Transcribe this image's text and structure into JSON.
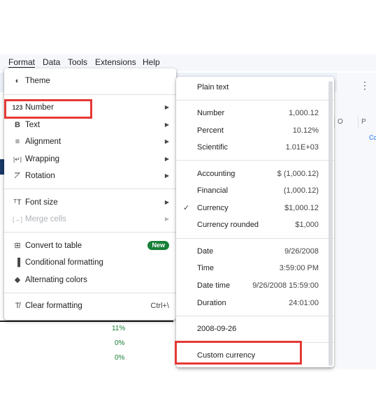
{
  "menubar": {
    "items": [
      "Format",
      "Data",
      "Tools",
      "Extensions",
      "Help"
    ]
  },
  "format_menu": {
    "items": [
      {
        "icon": "palette-icon",
        "glyph": "◐",
        "label": "Theme"
      },
      {
        "icon": "number-format-icon",
        "glyph": "123",
        "label": "Number"
      },
      {
        "icon": "bold-icon",
        "glyph": "B",
        "label": "Text"
      },
      {
        "icon": "align-icon",
        "glyph": "≡",
        "label": "Alignment"
      },
      {
        "icon": "wrap-icon",
        "glyph": "|↵|",
        "label": "Wrapping"
      },
      {
        "icon": "rotate-icon",
        "glyph": "⦢",
        "label": "Rotation"
      },
      {
        "icon": "font-size-icon",
        "glyph": "ᵀT",
        "label": "Font size"
      },
      {
        "icon": "merge-icon",
        "glyph": "[↔]",
        "label": "Merge cells"
      },
      {
        "icon": "table-icon",
        "glyph": "⊞",
        "label": "Convert to table"
      },
      {
        "icon": "paint-roller-icon",
        "glyph": "▐",
        "label": "Conditional formatting"
      },
      {
        "icon": "fill-drop-icon",
        "glyph": "◆",
        "label": "Alternating colors"
      },
      {
        "icon": "clear-format-icon",
        "glyph": "T̸",
        "label": "Clear formatting"
      }
    ],
    "new_badge": "New",
    "clear_shortcut": "Ctrl+\\"
  },
  "number_submenu": {
    "plain_text": "Plain text",
    "group1": [
      {
        "label": "Number",
        "value": "1,000.12"
      },
      {
        "label": "Percent",
        "value": "10.12%"
      },
      {
        "label": "Scientific",
        "value": "1.01E+03"
      }
    ],
    "group2": [
      {
        "label": "Accounting",
        "value": "$ (1,000.12)"
      },
      {
        "label": "Financial",
        "value": "(1,000.12)"
      },
      {
        "label": "Currency",
        "value": "$1,000.12",
        "checked": true
      },
      {
        "label": "Currency rounded",
        "value": "$1,000"
      }
    ],
    "group3": [
      {
        "label": "Date",
        "value": "9/26/2008"
      },
      {
        "label": "Time",
        "value": "3:59:00 PM"
      },
      {
        "label": "Date time",
        "value": "9/26/2008 15:59:00"
      },
      {
        "label": "Duration",
        "value": "24:01:00"
      }
    ],
    "recent": "2008-09-26",
    "custom_currency": "Custom currency",
    "check_glyph": "✓"
  },
  "sheet": {
    "col_o": "O",
    "col_p": "P",
    "side_c": "Cc",
    "percent_cells": [
      "11%",
      "0%",
      "0%"
    ],
    "more_icon": "⋮"
  },
  "colors": {
    "highlight": "#e53935",
    "new_badge": "#188038",
    "percent_text": "#188038"
  }
}
